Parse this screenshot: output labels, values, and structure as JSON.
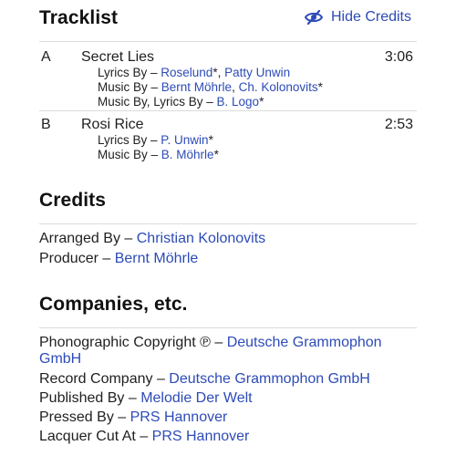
{
  "tracklist": {
    "title": "Tracklist",
    "hide_credits_label": "Hide Credits",
    "tracks": [
      {
        "position": "A",
        "title": "Secret Lies",
        "duration": "3:06",
        "credits": [
          {
            "role": "Lyrics By",
            "sep": " – ",
            "names": [
              {
                "name": "Roselund",
                "suffix": "*"
              },
              {
                "name": "Patty Unwin",
                "suffix": ""
              }
            ]
          },
          {
            "role": "Music By",
            "sep": " – ",
            "names": [
              {
                "name": "Bernt Möhrle",
                "suffix": ""
              },
              {
                "name": "Ch. Kolonovits",
                "suffix": "*"
              }
            ]
          },
          {
            "role": "Music By, Lyrics By",
            "sep": " – ",
            "names": [
              {
                "name": "B. Logo",
                "suffix": "*"
              }
            ]
          }
        ]
      },
      {
        "position": "B",
        "title": "Rosi Rice",
        "duration": "2:53",
        "credits": [
          {
            "role": "Lyrics By",
            "sep": " – ",
            "names": [
              {
                "name": "P. Unwin",
                "suffix": "*"
              }
            ]
          },
          {
            "role": "Music By",
            "sep": " – ",
            "names": [
              {
                "name": "B. Möhrle",
                "suffix": "*"
              }
            ]
          }
        ]
      }
    ]
  },
  "credits": {
    "title": "Credits",
    "items": [
      {
        "role": "Arranged By",
        "sep": " – ",
        "name": "Christian Kolonovits"
      },
      {
        "role": "Producer",
        "sep": " – ",
        "name": "Bernt Möhrle"
      }
    ]
  },
  "companies": {
    "title": "Companies, etc.",
    "items": [
      {
        "role": "Phonographic Copyright ℗",
        "sep": " – ",
        "name": "Deutsche Grammophon GmbH"
      },
      {
        "role": "Record Company",
        "sep": " – ",
        "name": "Deutsche Grammophon GmbH"
      },
      {
        "role": "Published By",
        "sep": " – ",
        "name": "Melodie Der Welt"
      },
      {
        "role": "Pressed By",
        "sep": " – ",
        "name": "PRS Hannover"
      },
      {
        "role": "Lacquer Cut At",
        "sep": " – ",
        "name": "PRS Hannover"
      }
    ]
  },
  "colors": {
    "link": "#2d4bb7",
    "text": "#1f1f1f",
    "rule": "#dcdcdc"
  },
  "icons": {
    "hide_credits": "eye-slash-icon"
  }
}
